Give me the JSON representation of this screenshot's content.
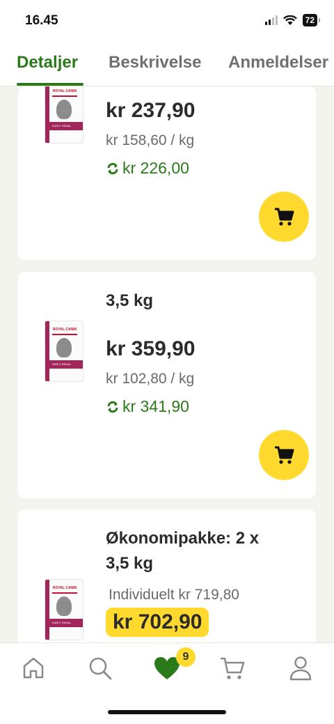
{
  "status_bar": {
    "time": "16.45",
    "battery": "72"
  },
  "tabs": [
    {
      "label": "Detaljer",
      "active": true
    },
    {
      "label": "Beskrivelse",
      "active": false
    },
    {
      "label": "Anmeldelser",
      "active": false
    }
  ],
  "products": [
    {
      "price": "kr 237,90",
      "per_kg": "kr 158,60 / kg",
      "repeat_price": "kr 226,00"
    },
    {
      "variant": "3,5 kg",
      "price": "kr 359,90",
      "per_kg": "kr 102,80 / kg",
      "repeat_price": "kr 341,90"
    },
    {
      "variant_line1": "Økonomipakke: 2 x",
      "variant_line2": "3,5 kg",
      "individual_price": "Individuelt kr 719,80",
      "deal_price": "kr 702,90"
    }
  ],
  "product_image": {
    "brand": "ROYAL CANIN",
    "line": "EARLY RENAL"
  },
  "bottom_nav": {
    "items": [
      "home-icon",
      "search-icon",
      "heart-icon",
      "cart-icon",
      "user-icon"
    ],
    "wishlist_count": "9"
  },
  "colors": {
    "accent_green": "#2a7a1a",
    "yellow": "#ffd92e"
  }
}
